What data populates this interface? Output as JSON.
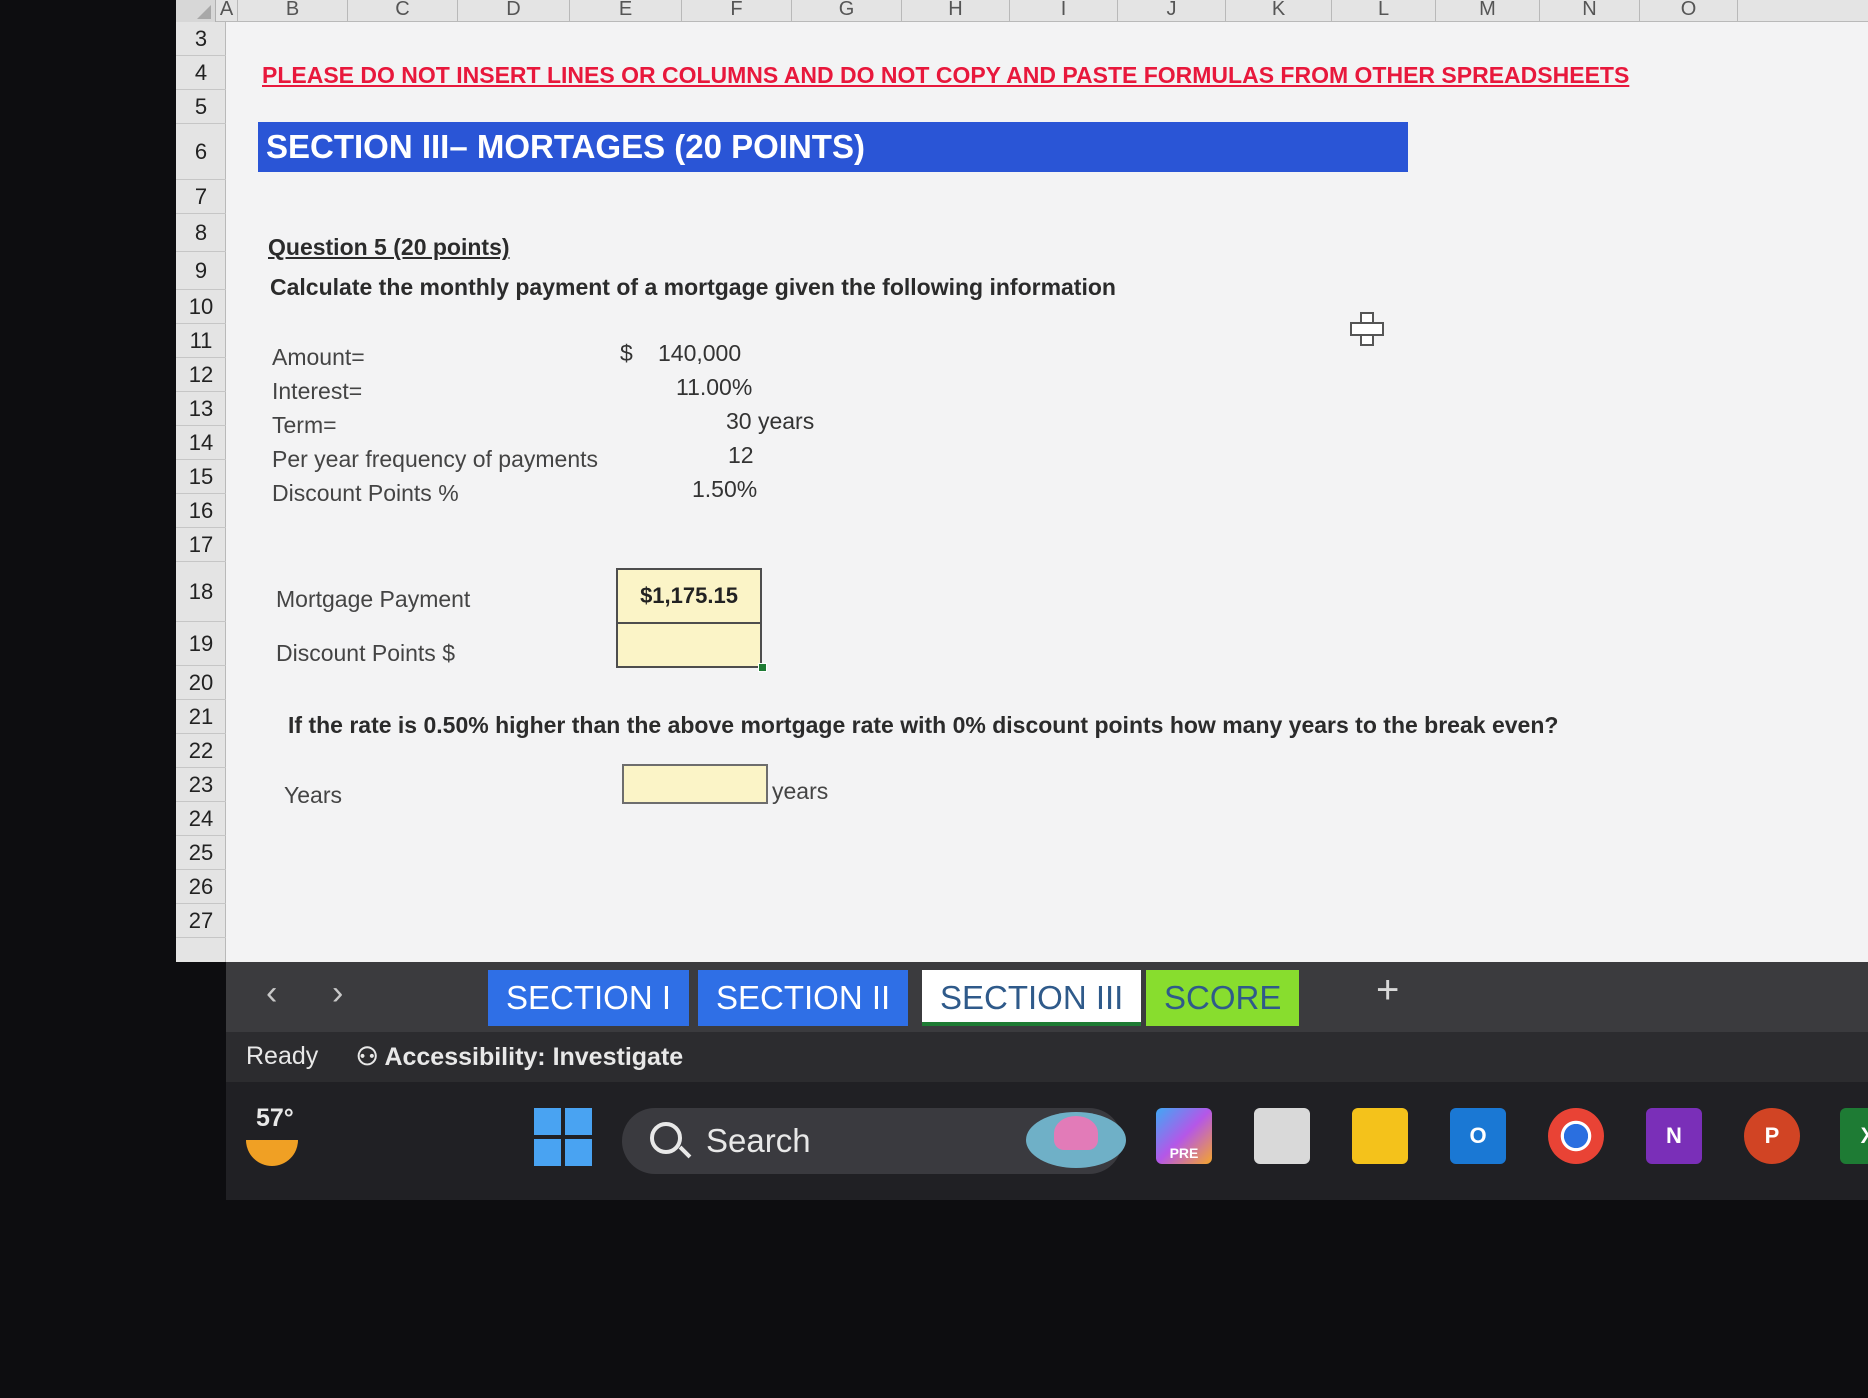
{
  "column_headers": [
    "A",
    "B",
    "C",
    "D",
    "E",
    "F",
    "G",
    "H",
    "I",
    "J",
    "K",
    "L",
    "M",
    "N",
    "O"
  ],
  "row_numbers": [
    "3",
    "4",
    "5",
    "6",
    "7",
    "8",
    "9",
    "10",
    "11",
    "12",
    "13",
    "14",
    "15",
    "16",
    "17",
    "18",
    "19",
    "20",
    "21",
    "22",
    "23",
    "24",
    "25",
    "26",
    "27"
  ],
  "sheet": {
    "warning": "PLEASE DO NOT INSERT LINES OR COLUMNS AND DO NOT COPY AND PASTE FORMULAS FROM OTHER SPREADSHEETS",
    "section_title": "SECTION III– MORTAGES (20 POINTS)",
    "question_title": "Question 5 (20 points)",
    "question_text": "Calculate the monthly payment of a mortgage given the following information",
    "inputs": [
      {
        "label": "Amount=",
        "currency": "$",
        "value": "140,000"
      },
      {
        "label": "Interest=",
        "currency": "",
        "value": "11.00%"
      },
      {
        "label": "Term=",
        "currency": "",
        "value": "30 years"
      },
      {
        "label": "Per year frequency of payments",
        "currency": "",
        "value": "12"
      },
      {
        "label": "Discount Points %",
        "currency": "",
        "value": "1.50%"
      }
    ],
    "mortgage_payment_label": "Mortgage Payment",
    "mortgage_payment_value": "$1,175.15",
    "discount_points_label": "Discount Points $",
    "discount_points_value": "",
    "question2": "If the rate is 0.50% higher than the above mortgage rate with 0% discount points how many years to the break even?",
    "years_label": "Years",
    "years_value": "",
    "years_unit": "years"
  },
  "tabs": [
    {
      "label": "SECTION I",
      "style": "blue"
    },
    {
      "label": "SECTION II",
      "style": "blue"
    },
    {
      "label": "SECTION III",
      "style": "active"
    },
    {
      "label": "SCORE",
      "style": "green"
    }
  ],
  "add_sheet": "+",
  "status": {
    "ready": "Ready",
    "accessibility": "Accessibility: Investigate"
  },
  "taskbar": {
    "weather_temp": "57°",
    "search_placeholder": "Search",
    "apps": [
      {
        "icon": "copilot-icon",
        "label": "PRE"
      },
      {
        "icon": "task-view-icon",
        "label": ""
      },
      {
        "icon": "file-explorer-icon",
        "label": ""
      },
      {
        "icon": "outlook-icon",
        "label": "O"
      },
      {
        "icon": "chrome-icon",
        "label": ""
      },
      {
        "icon": "onenote-icon",
        "label": "N"
      },
      {
        "icon": "powerpoint-icon",
        "label": "P"
      },
      {
        "icon": "excel-icon",
        "label": "X"
      }
    ]
  },
  "colors": {
    "warning": "#e8183c",
    "section_banner": "#2a55d6",
    "tab_blue": "#2f6fe6",
    "tab_green": "#88dd2e",
    "input_fill": "#fbf4c7"
  }
}
